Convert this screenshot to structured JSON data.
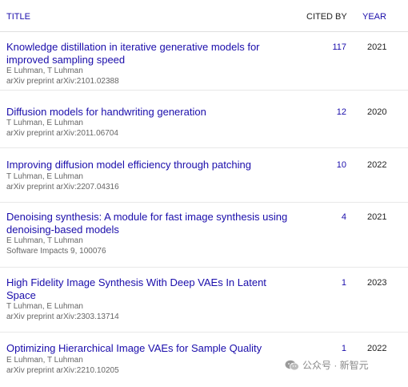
{
  "header": {
    "title": "TITLE",
    "cited_by": "CITED BY",
    "year": "YEAR"
  },
  "papers": [
    {
      "title": "Knowledge distillation in iterative generative models for improved sampling speed",
      "authors": "E Luhman, T Luhman",
      "venue": "arXiv preprint arXiv:2101.02388",
      "cited": "117",
      "year": "2021"
    },
    {
      "title": "Diffusion models for handwriting generation",
      "authors": "T Luhman, E Luhman",
      "venue": "arXiv preprint arXiv:2011.06704",
      "cited": "12",
      "year": "2020"
    },
    {
      "title": "Improving diffusion model efficiency through patching",
      "authors": "T Luhman, E Luhman",
      "venue": "arXiv preprint arXiv:2207.04316",
      "cited": "10",
      "year": "2022"
    },
    {
      "title": "Denoising synthesis: A module for fast image synthesis using denoising-based models",
      "authors": "E Luhman, T Luhman",
      "venue": "Software Impacts 9, 100076",
      "cited": "4",
      "year": "2021"
    },
    {
      "title": "High Fidelity Image Synthesis With Deep VAEs In Latent Space",
      "authors": "T Luhman, E Luhman",
      "venue": "arXiv preprint arXiv:2303.13714",
      "cited": "1",
      "year": "2023"
    },
    {
      "title": "Optimizing Hierarchical Image VAEs for Sample Quality",
      "authors": "E Luhman, T Luhman",
      "venue": "arXiv preprint arXiv:2210.10205",
      "cited": "1",
      "year": "2022"
    }
  ],
  "watermark": {
    "text": "公众号 · 新智元",
    "icon": "wechat-icon"
  }
}
